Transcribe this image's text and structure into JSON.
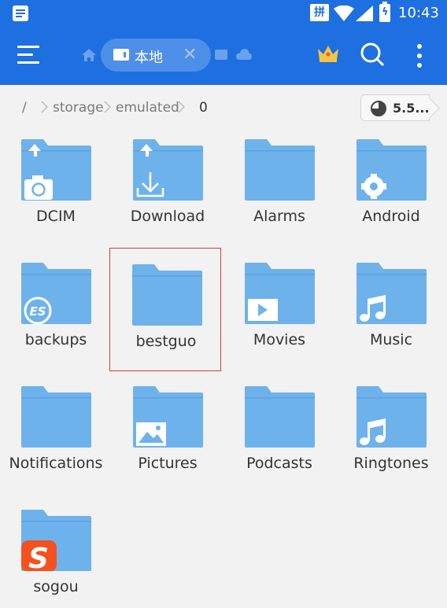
{
  "status_bar": {
    "time": "10:43",
    "ime_label": "拼"
  },
  "toolbar": {
    "tab_label": "本地",
    "tab_close": "✕"
  },
  "breadcrumb": {
    "root": "/",
    "items": [
      "storage",
      "emulated",
      "0"
    ],
    "storage_chip": "5.5..."
  },
  "folders": [
    {
      "name": "DCIM",
      "badge": "camera"
    },
    {
      "name": "Download",
      "badge": "download"
    },
    {
      "name": "Alarms",
      "badge": ""
    },
    {
      "name": "Android",
      "badge": "gear"
    },
    {
      "name": "backups",
      "badge": "es-logo"
    },
    {
      "name": "bestguo",
      "badge": "",
      "selected": true
    },
    {
      "name": "Movies",
      "badge": "play"
    },
    {
      "name": "Music",
      "badge": "music-note"
    },
    {
      "name": "Notifications",
      "badge": ""
    },
    {
      "name": "Pictures",
      "badge": "image"
    },
    {
      "name": "Podcasts",
      "badge": ""
    },
    {
      "name": "Ringtones",
      "badge": "music-note"
    },
    {
      "name": "sogou",
      "badge": "sogou-logo"
    }
  ],
  "colors": {
    "toolbar": "#1e6fe0",
    "folder": "#6eb2ec",
    "selection": "#d83a3a",
    "background": "#f2f2f2"
  }
}
